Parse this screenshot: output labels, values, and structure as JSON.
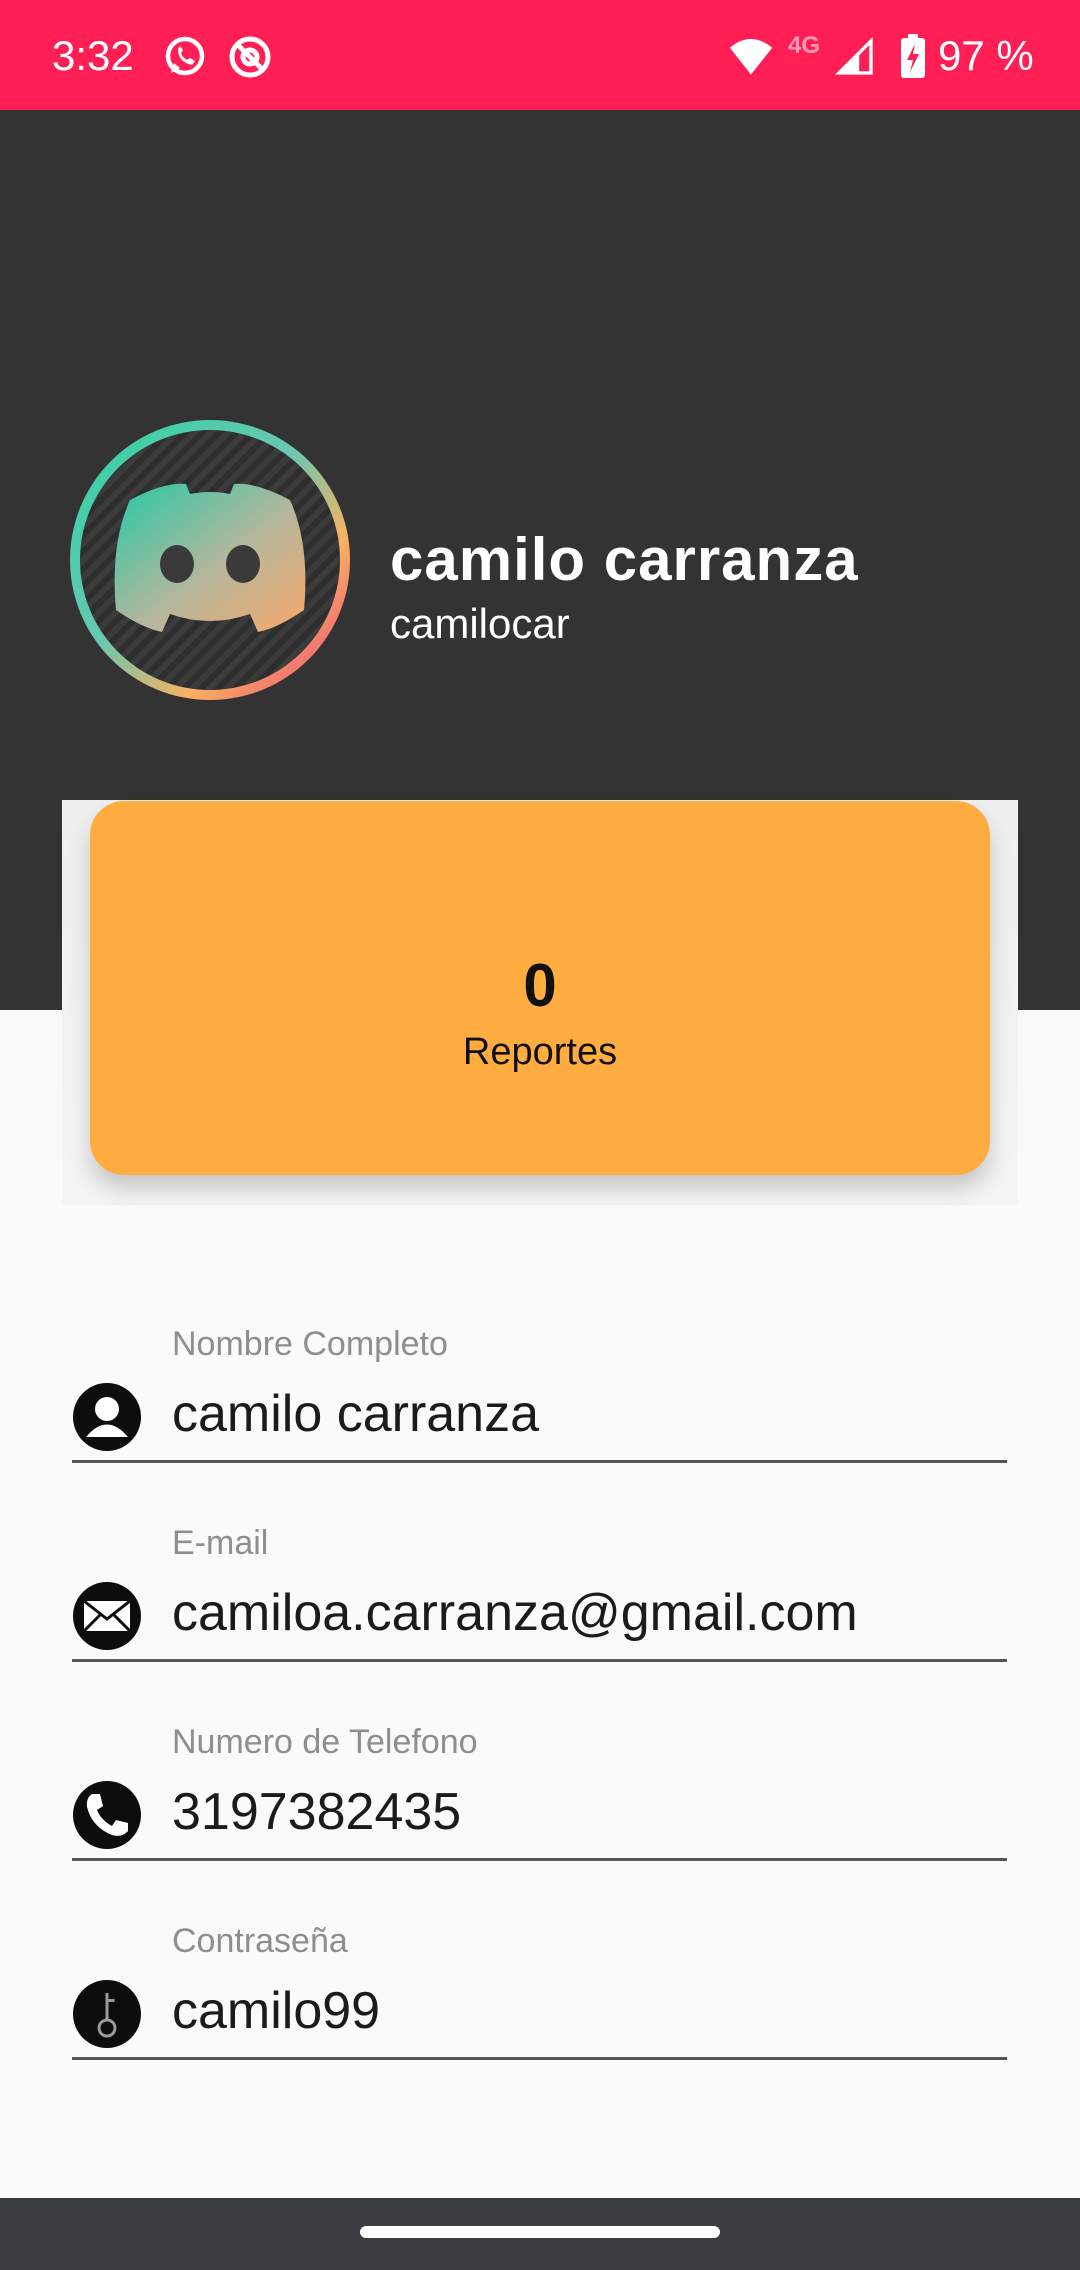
{
  "status_bar": {
    "time": "3:32",
    "network": "4G",
    "battery": "97 %",
    "icons": [
      "whatsapp-icon",
      "at-sign-icon",
      "wifi-icon",
      "signal-icon",
      "battery-charging-icon"
    ]
  },
  "profile": {
    "name": "camilo carranza",
    "username": "camilocar",
    "avatar_icon": "discord-logo"
  },
  "reports": {
    "count": "0",
    "label": "Reportes"
  },
  "fields": [
    {
      "label": "Nombre Completo",
      "value": "camilo carranza",
      "icon": "person-icon"
    },
    {
      "label": "E-mail",
      "value": "camiloa.carranza@gmail.com",
      "icon": "envelope-icon"
    },
    {
      "label": "Numero de Telefono",
      "value": "3197382435",
      "icon": "phone-icon"
    },
    {
      "label": "Contraseña",
      "value": "camilo99",
      "icon": "key-icon"
    }
  ],
  "colors": {
    "status_bar": "#ff1f55",
    "header": "#333333",
    "card": "#ffac40",
    "nav_bar": "#3a3e43"
  }
}
